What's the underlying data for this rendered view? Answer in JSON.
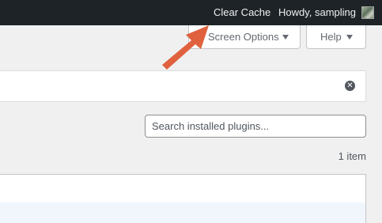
{
  "adminbar": {
    "clear_cache": "Clear Cache",
    "account": "Howdy, sampling"
  },
  "screen_meta": {
    "screen_options": "Screen Options",
    "help": "Help"
  },
  "search": {
    "placeholder": "Search installed plugins..."
  },
  "list": {
    "count": "1 item"
  },
  "colors": {
    "adminbar": "#1d2327",
    "arrow": "#e0613e"
  }
}
